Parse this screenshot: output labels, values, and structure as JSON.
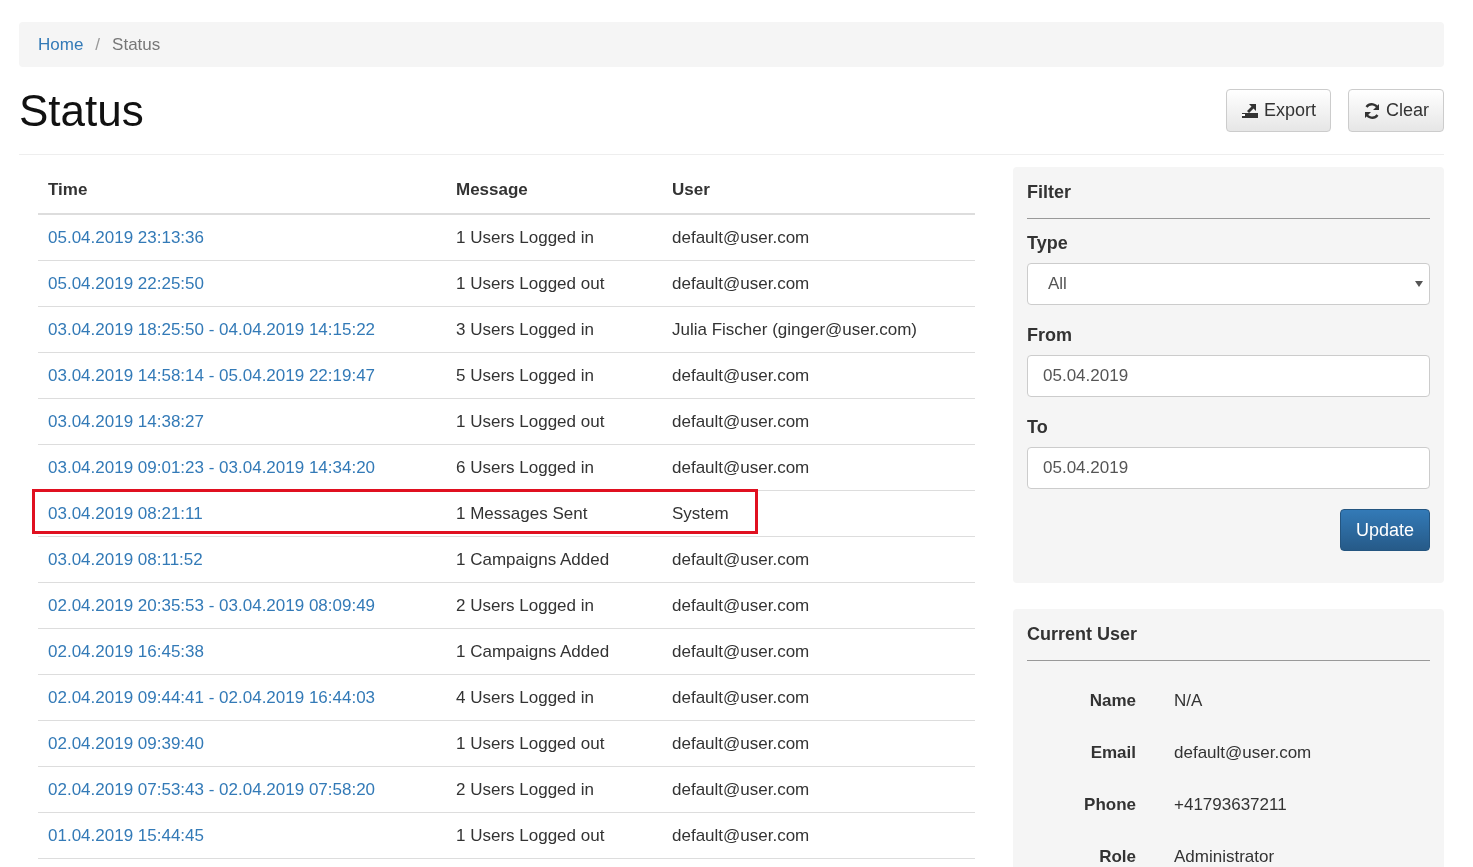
{
  "breadcrumb": [
    "Home",
    "Status"
  ],
  "breadcrumb_separator": "/",
  "title": "Status",
  "actions": [
    {
      "label": "Export",
      "kind": "export"
    },
    {
      "label": "Clear",
      "kind": "clear"
    }
  ],
  "table": {
    "columns": [
      "Time",
      "Message",
      "User"
    ],
    "rows": [
      {
        "time": "05.04.2019 23:13:36",
        "message": "1 Users Logged in",
        "user": "default@user.com",
        "highlighted": false
      },
      {
        "time": "05.04.2019 22:25:50",
        "message": "1 Users Logged out",
        "user": "default@user.com",
        "highlighted": false
      },
      {
        "time": "03.04.2019 18:25:50 - 04.04.2019 14:15:22",
        "message": "3 Users Logged in",
        "user": "Julia Fischer (ginger@user.com)",
        "highlighted": false
      },
      {
        "time": "03.04.2019 14:58:14 - 05.04.2019 22:19:47",
        "message": "5 Users Logged in",
        "user": "default@user.com",
        "highlighted": false
      },
      {
        "time": "03.04.2019 14:38:27",
        "message": "1 Users Logged out",
        "user": "default@user.com",
        "highlighted": false
      },
      {
        "time": "03.04.2019 09:01:23 - 03.04.2019 14:34:20",
        "message": "6 Users Logged in",
        "user": "default@user.com",
        "highlighted": false
      },
      {
        "time": "03.04.2019 08:21:11",
        "message": "1 Messages Sent",
        "user": "System",
        "highlighted": true
      },
      {
        "time": "03.04.2019 08:11:52",
        "message": "1 Campaigns Added",
        "user": "default@user.com",
        "highlighted": false
      },
      {
        "time": "02.04.2019 20:35:53 - 03.04.2019 08:09:49",
        "message": "2 Users Logged in",
        "user": "default@user.com",
        "highlighted": false
      },
      {
        "time": "02.04.2019 16:45:38",
        "message": "1 Campaigns Added",
        "user": "default@user.com",
        "highlighted": false
      },
      {
        "time": "02.04.2019 09:44:41 - 02.04.2019 16:44:03",
        "message": "4 Users Logged in",
        "user": "default@user.com",
        "highlighted": false
      },
      {
        "time": "02.04.2019 09:39:40",
        "message": "1 Users Logged out",
        "user": "default@user.com",
        "highlighted": false
      },
      {
        "time": "02.04.2019 07:53:43 - 02.04.2019 07:58:20",
        "message": "2 Users Logged in",
        "user": "default@user.com",
        "highlighted": false
      },
      {
        "time": "01.04.2019 15:44:45",
        "message": "1 Users Logged out",
        "user": "default@user.com",
        "highlighted": false
      }
    ]
  },
  "filter": {
    "title": "Filter",
    "type_label": "Type",
    "type_value": "All",
    "from_label": "From",
    "from_value": "05.04.2019",
    "to_label": "To",
    "to_value": "05.04.2019",
    "button": "Update"
  },
  "current_user": {
    "title": "Current User",
    "fields": [
      {
        "label": "Name",
        "value": "N/A"
      },
      {
        "label": "Email",
        "value": "default@user.com"
      },
      {
        "label": "Phone",
        "value": "+41793637211"
      },
      {
        "label": "Role",
        "value": "Administrator"
      }
    ]
  }
}
